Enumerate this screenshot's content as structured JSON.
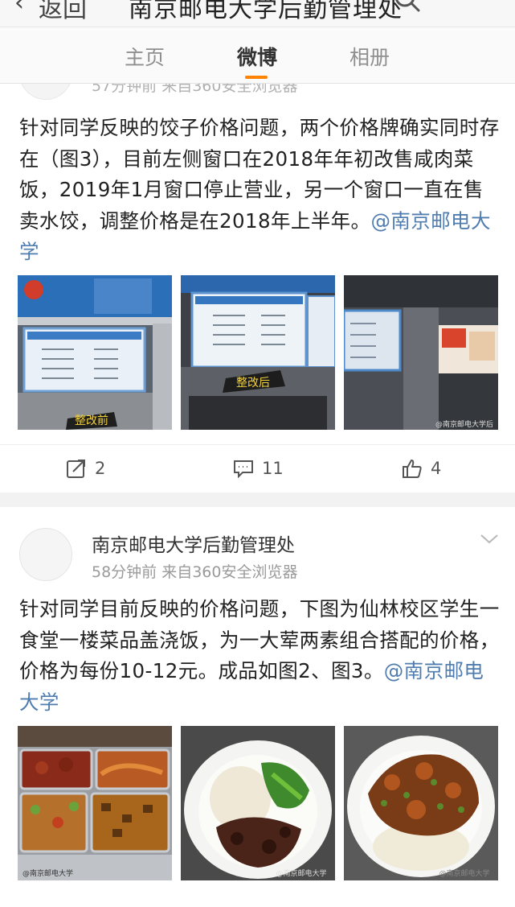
{
  "header": {
    "back_label": "返回",
    "title": "南京邮电大学后勤管理处"
  },
  "tabs": [
    {
      "label": "主页",
      "active": false
    },
    {
      "label": "微博",
      "active": true
    },
    {
      "label": "相册",
      "active": false
    }
  ],
  "accent_color": "#ff8200",
  "link_color": "#507daf",
  "posts": [
    {
      "meta": "57分钟前  来自360安全浏览器",
      "text": "针对同学反映的饺子价格问题，两个价格牌确实同时存在（图3），目前左侧窗口在2018年年初改售咸肉菜饭，2019年1月窗口停止营业，另一个窗口一直在售卖水饺，调整价格是在2018年上半年。",
      "mention": "@南京邮电大学",
      "photo_labels": [
        "整改前",
        "整改后",
        ""
      ],
      "watermark": "@南京邮电大学后",
      "actions": {
        "repost": "2",
        "comment": "11",
        "like": "4"
      }
    },
    {
      "author": "南京邮电大学后勤管理处",
      "meta": "58分钟前  来自360安全浏览器",
      "text": "针对同学目前反映的价格问题，下图为仙林校区学生一食堂一楼菜品盖浇饭，为一大荤两素组合搭配的价格，价格为每份10-12元。成品如图2、图3。",
      "mention": "@南京邮电大学",
      "watermarks": [
        "@南京邮电大学",
        "@南京邮电大学",
        "@南京邮电大学"
      ]
    }
  ]
}
